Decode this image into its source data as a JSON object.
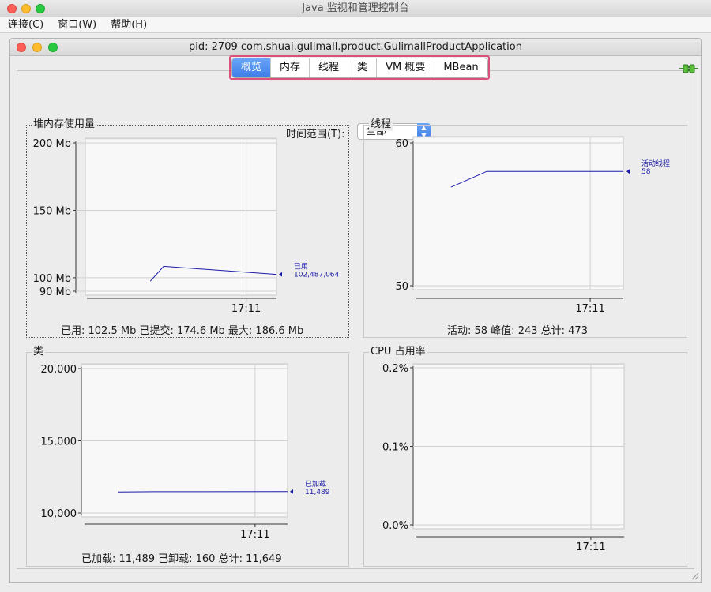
{
  "window": {
    "title": "Java 监视和管理控制台"
  },
  "menu": [
    "连接(C)",
    "窗口(W)",
    "帮助(H)"
  ],
  "inner_window": {
    "title": "pid: 2709 com.shuai.gulimall.product.GulimallProductApplication"
  },
  "tabs": [
    "概览",
    "内存",
    "线程",
    "类",
    "VM 概要",
    "MBean"
  ],
  "active_tab": "概览",
  "time_range": {
    "label": "时间范围(T):",
    "value": "全部"
  },
  "colors": {
    "accent": "#3d7de8",
    "series": "#1a1aa8",
    "highlight": "#d9507a"
  },
  "icons": {
    "connection": "plug-icon"
  },
  "panels": {
    "heap": {
      "title": "堆内存使用量",
      "stats": "已用: 102.5 Mb    已提交: 174.6 Mb    最大: 186.6 Mb"
    },
    "threads": {
      "title": "线程",
      "stats": "活动: 58    峰值: 243    总计: 473"
    },
    "classes": {
      "title": "类",
      "stats": "已加载: 11,489    已卸载: 160    总计: 11,649"
    },
    "cpu": {
      "title": "CPU 占用率"
    }
  },
  "chart_data": [
    {
      "type": "line",
      "title": "堆内存使用量",
      "ylim": [
        90,
        200
      ],
      "y_ticks": [
        "200 Mb",
        "150 Mb",
        "100 Mb",
        "90 Mb"
      ],
      "y_tick_values": [
        200,
        150,
        100,
        90
      ],
      "x_ticks": [
        "17:11"
      ],
      "x_tick_positions": [
        0.84
      ],
      "series": [
        {
          "name": "已用",
          "value_label": "102,487,064",
          "x": [
            0.34,
            0.41,
            1.0
          ],
          "y": [
            97.5,
            108.5,
            102.5
          ]
        }
      ]
    },
    {
      "type": "line",
      "title": "线程",
      "ylim": [
        50,
        60
      ],
      "y_ticks": [
        "60",
        "50"
      ],
      "y_tick_values": [
        60,
        50
      ],
      "x_ticks": [
        "17:11"
      ],
      "x_tick_positions": [
        0.84
      ],
      "series": [
        {
          "name": "活动线程",
          "value_label": "58",
          "x": [
            0.18,
            0.35,
            1.0
          ],
          "y": [
            56.9,
            58,
            58
          ]
        }
      ]
    },
    {
      "type": "line",
      "title": "类",
      "ylim": [
        10000,
        20000
      ],
      "y_ticks": [
        "20,000",
        "15,000",
        "10,000"
      ],
      "y_tick_values": [
        20000,
        15000,
        10000
      ],
      "x_ticks": [
        "17:11"
      ],
      "x_tick_positions": [
        0.84
      ],
      "series": [
        {
          "name": "已加载",
          "value_label": "11,489",
          "x": [
            0.18,
            0.35,
            1.0
          ],
          "y": [
            11460,
            11480,
            11489
          ]
        }
      ]
    },
    {
      "type": "line",
      "title": "CPU 占用率",
      "ylim": [
        0,
        0.2
      ],
      "y_ticks": [
        "0.2%",
        "0.1%",
        "0.0%"
      ],
      "y_tick_values": [
        0.2,
        0.1,
        0
      ],
      "x_ticks": [
        "17:11"
      ],
      "x_tick_positions": [
        0.84
      ],
      "series": []
    }
  ]
}
